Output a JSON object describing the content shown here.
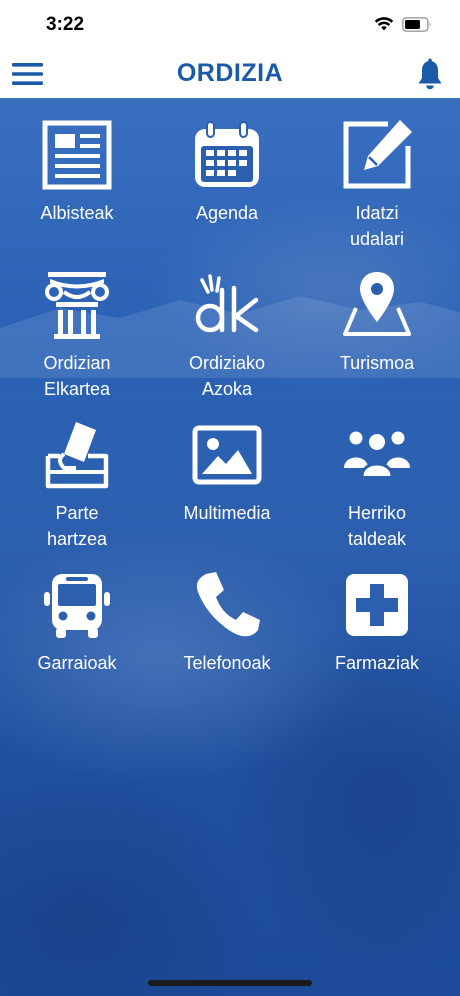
{
  "status_bar": {
    "time": "3:22"
  },
  "header": {
    "title": "ORDIZIA"
  },
  "colors": {
    "brand": "#1a5aa8",
    "overlay": "#2c5fae"
  },
  "menu": [
    {
      "label": "Albisteak",
      "icon": "newspaper-icon"
    },
    {
      "label": "Agenda",
      "icon": "calendar-icon"
    },
    {
      "label": "Idatzi\nudalari",
      "icon": "edit-icon"
    },
    {
      "label": "Ordizian\nElkartea",
      "icon": "column-capital-icon"
    },
    {
      "label": "Ordiziako\nAzoka",
      "icon": "dk-logo-icon"
    },
    {
      "label": "Turismoa",
      "icon": "map-pin-icon"
    },
    {
      "label": "Parte\nhartzea",
      "icon": "ballot-box-icon"
    },
    {
      "label": "Multimedia",
      "icon": "image-icon"
    },
    {
      "label": "Herriko\ntaldeak",
      "icon": "group-icon"
    },
    {
      "label": "Garraioak",
      "icon": "bus-icon"
    },
    {
      "label": "Telefonoak",
      "icon": "phone-icon"
    },
    {
      "label": "Farmaziak",
      "icon": "pharmacy-icon"
    }
  ]
}
